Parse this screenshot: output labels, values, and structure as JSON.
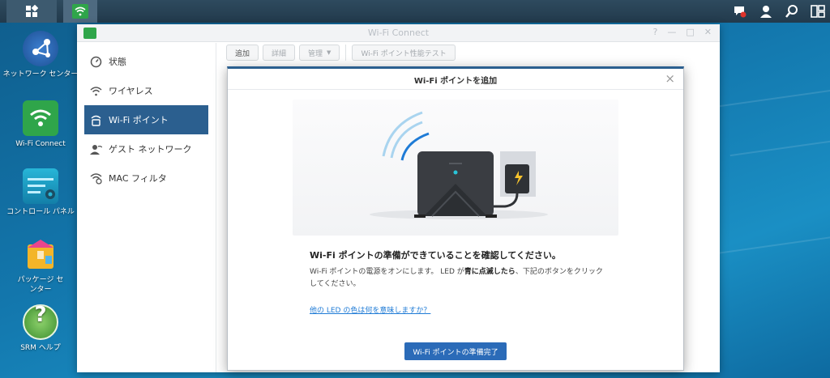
{
  "taskbar": {
    "main_menu_icon": "grid-icon",
    "app_icon": "wifi-icon",
    "right_icons": [
      "notification-icon",
      "user-icon",
      "search-icon",
      "widgets-icon"
    ]
  },
  "desktop": {
    "icons": [
      {
        "label": "ネットワーク センター",
        "icon": "network-center-icon"
      },
      {
        "label": "Wi-Fi Connect",
        "icon": "wifi-connect-icon"
      },
      {
        "label": "コントロール パネル",
        "icon": "control-panel-icon"
      },
      {
        "label": "パッケージ センター",
        "icon": "package-center-icon"
      },
      {
        "label": "SRM ヘルプ",
        "icon": "help-icon"
      }
    ]
  },
  "window": {
    "title": "Wi-Fi Connect",
    "sidebar": [
      {
        "label": "状態",
        "icon": "status-icon"
      },
      {
        "label": "ワイヤレス",
        "icon": "wireless-icon"
      },
      {
        "label": "Wi-Fi ポイント",
        "icon": "wifi-point-icon"
      },
      {
        "label": "ゲスト ネットワーク",
        "icon": "guest-network-icon"
      },
      {
        "label": "MAC フィルタ",
        "icon": "mac-filter-icon"
      }
    ],
    "active_index": 2,
    "toolbar": {
      "add": "追加",
      "details": "詳細",
      "manage": "管理",
      "perf_test": "Wi-Fi ポイント性能テスト"
    }
  },
  "modal": {
    "title": "Wi-Fi ポイントを追加",
    "heading": "Wi-Fi ポイントの準備ができていることを確認してください。",
    "body_1": "Wi-Fi ポイントの電源をオンにします。 LED が",
    "body_bold": "青に点滅したら",
    "body_2": "、下記のボタンをクリックしてください。",
    "link": "他の LED の色は何を意味しますか？",
    "button": "Wi-Fi ポイントの準備完了"
  },
  "colors": {
    "accent": "#2b5f8f",
    "button": "#2b6bb8",
    "link": "#1f7bd6",
    "wifi_green": "#2fa54a"
  }
}
